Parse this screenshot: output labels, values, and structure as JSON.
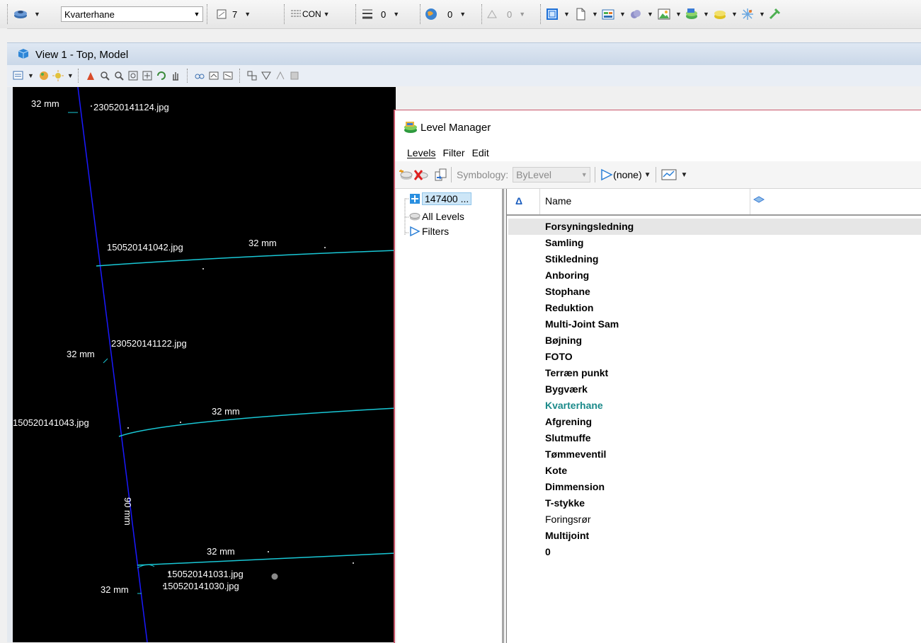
{
  "toolbar": {
    "active_level": "Kvarterhane",
    "color_value": "7",
    "line_style": "CON",
    "weight_value": "0",
    "transparency_value": "0",
    "priority_value": "0"
  },
  "view": {
    "title": "View 1 - Top, Model"
  },
  "drawing": {
    "labels": [
      {
        "text": "32 mm"
      },
      {
        "text": "230520141124.jpg"
      },
      {
        "text": "150520141042.jpg"
      },
      {
        "text": "32 mm"
      },
      {
        "text": "230520141122.jpg"
      },
      {
        "text": "32 mm"
      },
      {
        "text": "32 mm"
      },
      {
        "text": "150520141043.jpg"
      },
      {
        "text": "90 mm"
      },
      {
        "text": "32 mm"
      },
      {
        "text": "150520141031.jpg"
      },
      {
        "text": "32 mm"
      },
      {
        "text": "150520141030.jpg"
      }
    ]
  },
  "level_manager": {
    "title": "Level Manager",
    "menu": [
      "Levels",
      "Filter",
      "Edit"
    ],
    "symbology_label": "Symbology:",
    "symbology_value": "ByLevel",
    "filter_value": "(none)",
    "tree": [
      "147400 ...",
      "All Levels",
      "Filters"
    ],
    "columns": {
      "sort": "Δ",
      "name": "Name"
    },
    "levels": [
      {
        "name": "Forsyningsledning"
      },
      {
        "name": "Samling"
      },
      {
        "name": "Stikledning"
      },
      {
        "name": "Anboring"
      },
      {
        "name": "Stophane"
      },
      {
        "name": "Reduktion"
      },
      {
        "name": "Multi-Joint Sam"
      },
      {
        "name": "Bøjning"
      },
      {
        "name": "FOTO"
      },
      {
        "name": "Terræn punkt"
      },
      {
        "name": "Bygværk"
      },
      {
        "name": "Kvarterhane"
      },
      {
        "name": "Afgrening"
      },
      {
        "name": "Slutmuffe"
      },
      {
        "name": "Tømmeventil"
      },
      {
        "name": "Kote"
      },
      {
        "name": "Dimmension"
      },
      {
        "name": "T-stykke"
      },
      {
        "name": "Foringsrør"
      },
      {
        "name": "Multijoint"
      },
      {
        "name": "0"
      }
    ],
    "active_level_color": "#1b8a8a"
  }
}
